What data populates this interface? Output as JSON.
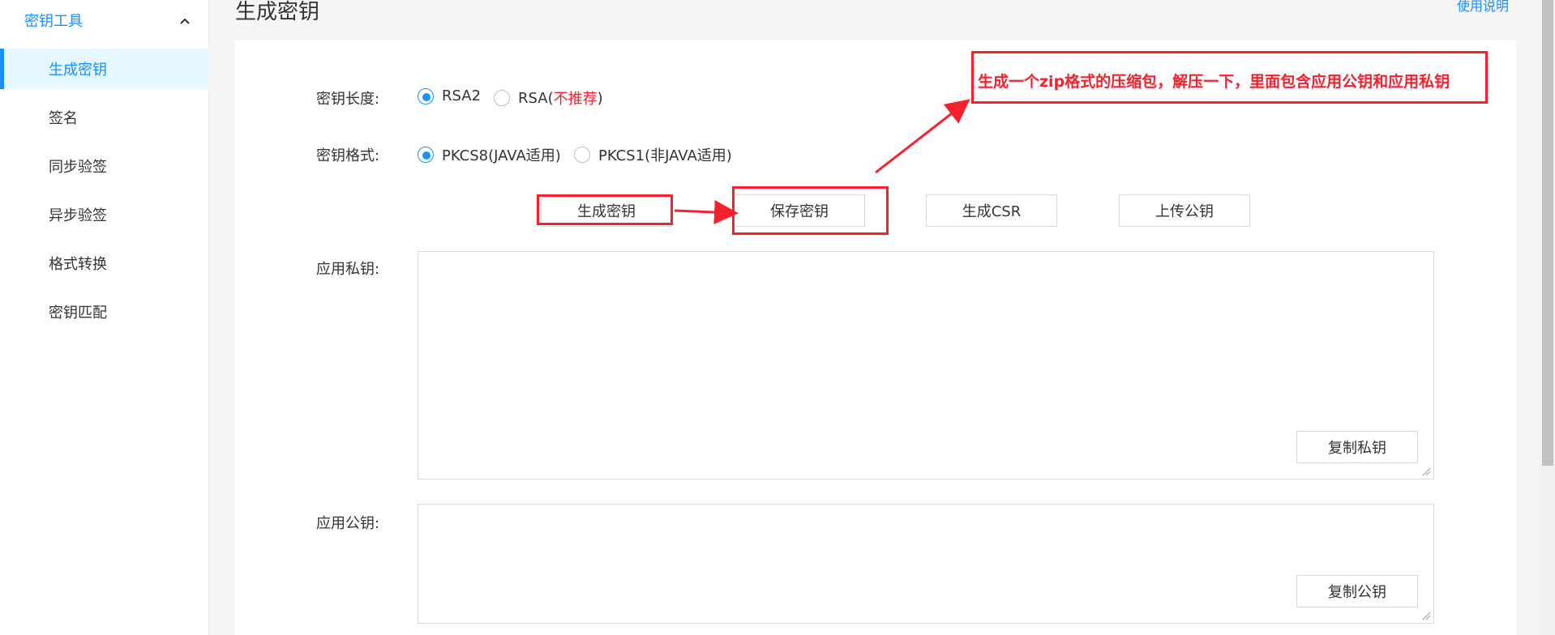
{
  "sidebar": {
    "group_label": "密钥工具",
    "items": [
      {
        "label": "生成密钥"
      },
      {
        "label": "签名"
      },
      {
        "label": "同步验签"
      },
      {
        "label": "异步验签"
      },
      {
        "label": "格式转换"
      },
      {
        "label": "密钥匹配"
      }
    ]
  },
  "header": {
    "title": "生成密钥",
    "help_link": "使用说明"
  },
  "form": {
    "key_length": {
      "label": "密钥长度:",
      "options": [
        {
          "label": "RSA2",
          "checked": true
        },
        {
          "label": "RSA(",
          "note": "不推荐",
          "suffix": ")",
          "checked": false
        }
      ]
    },
    "key_format": {
      "label": "密钥格式:",
      "options": [
        {
          "label": "PKCS8(JAVA适用)",
          "checked": true
        },
        {
          "label": "PKCS1(非JAVA适用)",
          "checked": false
        }
      ]
    },
    "buttons": {
      "generate": "生成密钥",
      "save": "保存密钥",
      "csr": "生成CSR",
      "upload": "上传公钥"
    },
    "private_key": {
      "label": "应用私钥:",
      "value": "",
      "copy_label": "复制私钥"
    },
    "public_key": {
      "label": "应用公钥:",
      "value": "",
      "copy_label": "复制公钥"
    }
  },
  "annotation": {
    "text": "生成一个zip格式的压缩包，解压一下，里面包含应用公钥和应用私钥"
  },
  "colors": {
    "accent": "#1890ff",
    "annotation": "#f5222d",
    "active_bg": "#e6f7ff"
  }
}
